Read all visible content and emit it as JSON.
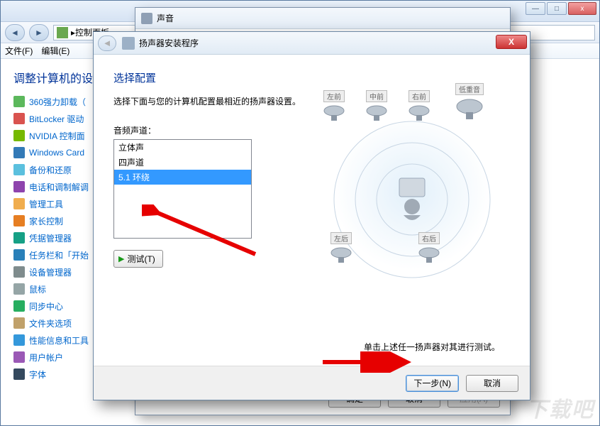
{
  "main": {
    "addr": "控制面板",
    "menu": {
      "file": "文件(F)",
      "edit": "编辑(E)"
    },
    "heading": "调整计算机的设",
    "sidebar": [
      {
        "label": "360强力卸载（",
        "color": "#5cb85c"
      },
      {
        "label": "BitLocker 驱动",
        "color": "#d9534f"
      },
      {
        "label": "NVIDIA 控制面",
        "color": "#76b900"
      },
      {
        "label": "Windows Card",
        "color": "#337ab7"
      },
      {
        "label": "备份和还原",
        "color": "#5bc0de"
      },
      {
        "label": "电话和调制解调",
        "color": "#8e44ad"
      },
      {
        "label": "管理工具",
        "color": "#f0ad4e"
      },
      {
        "label": "家长控制",
        "color": "#e67e22"
      },
      {
        "label": "凭据管理器",
        "color": "#16a085"
      },
      {
        "label": "任务栏和「开始",
        "color": "#2980b9"
      },
      {
        "label": "设备管理器",
        "color": "#7f8c8d"
      },
      {
        "label": "鼠标",
        "color": "#95a5a6"
      },
      {
        "label": "同步中心",
        "color": "#27ae60"
      },
      {
        "label": "文件夹选项",
        "color": "#c0a16b"
      },
      {
        "label": "性能信息和工具",
        "color": "#3498db"
      },
      {
        "label": "用户帐户",
        "color": "#9b59b6"
      },
      {
        "label": "字体",
        "color": "#34495e"
      }
    ]
  },
  "sound": {
    "title": "声音",
    "ok": "确定",
    "cancel": "取消",
    "apply": "应用(A)"
  },
  "wizard": {
    "title": "扬声器安装程序",
    "heading": "选择配置",
    "desc": "选择下面与您的计算机配置最相近的扬声器设置。",
    "list_label": "音频声道：",
    "options": [
      "立体声",
      "四声道",
      "5.1 环绕"
    ],
    "test": "测试(T)",
    "hint": "单击上述任一扬声器对其进行测试。",
    "next": "下一步(N)",
    "cancel": "取消",
    "speakers": {
      "lf": "左前",
      "cf": "中前",
      "rf": "右前",
      "sub": "低重音",
      "lr": "左后",
      "rr": "右后"
    }
  },
  "watermark": "下载吧"
}
